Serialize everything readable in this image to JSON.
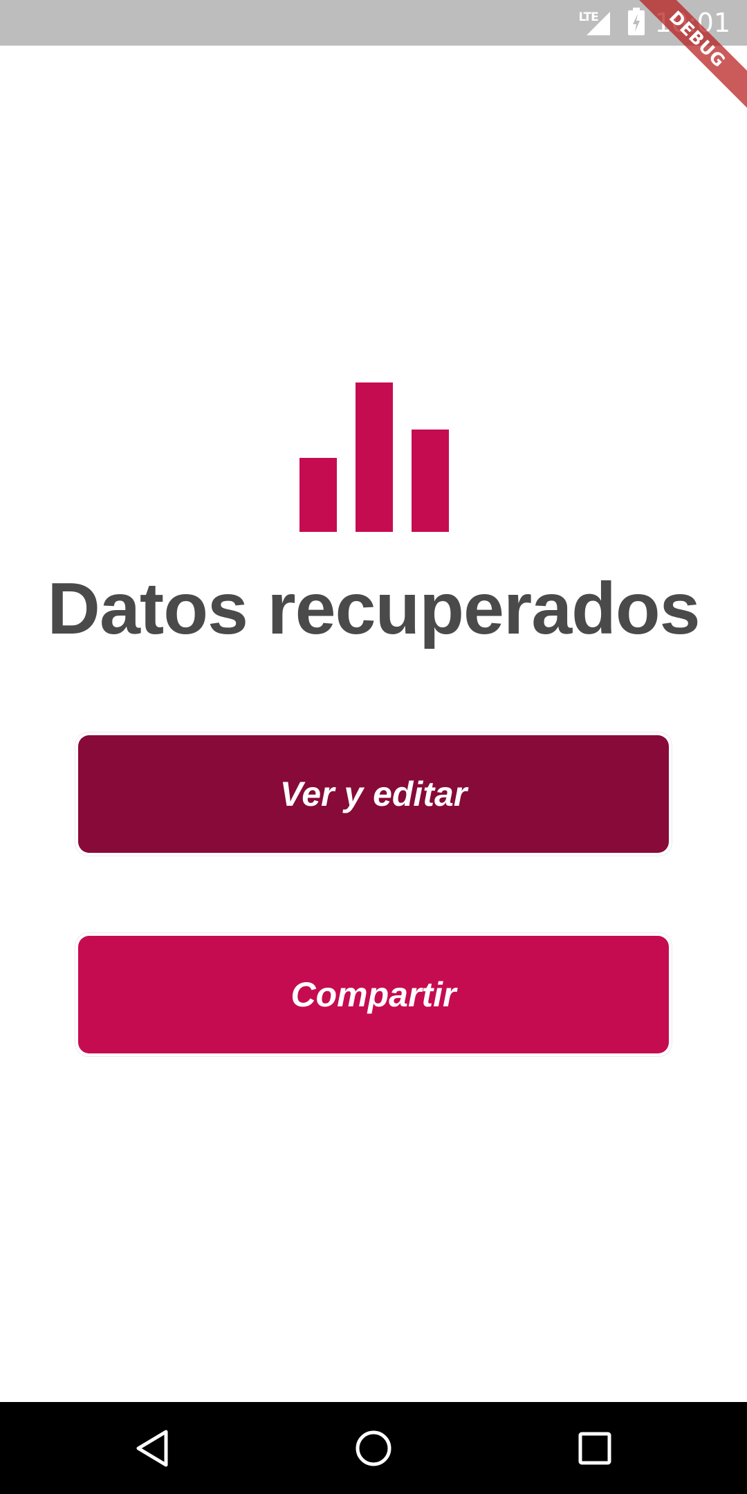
{
  "status_bar": {
    "network_label": "LTE",
    "time": "10:01",
    "icons": [
      "signal-icon",
      "battery-charging-icon"
    ]
  },
  "debug_banner": "DEBUG",
  "main": {
    "logo_icon": "bar-chart-icon",
    "title": "Datos recuperados",
    "buttons": {
      "view_edit": "Ver y editar",
      "share": "Compartir"
    }
  },
  "colors": {
    "accent": "#c60c50",
    "accent_dark": "#880a38",
    "title_text": "#4a4a4a",
    "status_bar": "#bdbdbd"
  },
  "nav_bar": {
    "icons": [
      "back-icon",
      "home-icon",
      "recents-icon"
    ]
  }
}
